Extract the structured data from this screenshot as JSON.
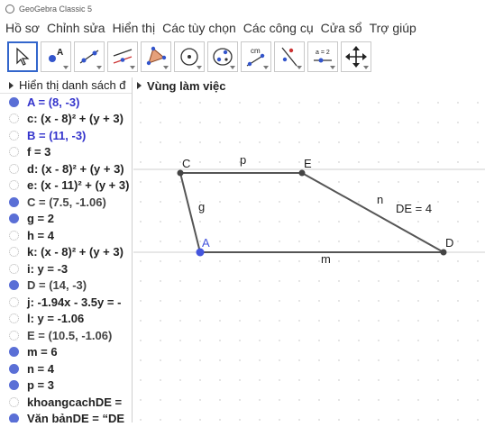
{
  "window": {
    "title": "GeoGebra Classic 5"
  },
  "menu": [
    "Hồ sơ",
    "Chỉnh sửa",
    "Hiển thị",
    "Các tùy chọn",
    "Các công cụ",
    "Cửa sổ",
    "Trợ giúp"
  ],
  "toolbar": {
    "tools": [
      {
        "name": "move-tool-button",
        "icon": "arrow-cursor-icon"
      },
      {
        "name": "point-tool-button",
        "icon": "point-icon"
      },
      {
        "name": "line-tool-button",
        "icon": "line-icon"
      },
      {
        "name": "perpendicular-tool-button",
        "icon": "perpendicular-icon"
      },
      {
        "name": "polygon-tool-button",
        "icon": "polygon-icon"
      },
      {
        "name": "circle-tool-button",
        "icon": "circle-icon"
      },
      {
        "name": "conic-tool-button",
        "icon": "ellipse-icon"
      },
      {
        "name": "distance-tool-button",
        "icon": "measure-icon"
      },
      {
        "name": "reflect-tool-button",
        "icon": "reflect-icon"
      },
      {
        "name": "slider-tool-button",
        "icon": "slider-icon"
      },
      {
        "name": "move-view-tool-button",
        "icon": "move-view-icon"
      }
    ],
    "measure_label": "cm",
    "slider_label": "a = 2"
  },
  "algebra": {
    "header": "Hiển thị danh sách đ",
    "items": [
      {
        "text": "A = (8, -3)",
        "visible": true,
        "color": "#3333cc"
      },
      {
        "text": "c: (x - 8)² + (y + 3)",
        "visible": false,
        "color": "#222222"
      },
      {
        "text": "B = (11, -3)",
        "visible": false,
        "color": "#3333cc"
      },
      {
        "text": "f = 3",
        "visible": false,
        "color": "#222222"
      },
      {
        "text": "d: (x - 8)² + (y + 3)",
        "visible": false,
        "color": "#222222"
      },
      {
        "text": "e: (x - 11)² + (y + 3)",
        "visible": false,
        "color": "#222222"
      },
      {
        "text": "C = (7.5, -1.06)",
        "visible": true,
        "color": "#444444"
      },
      {
        "text": "g = 2",
        "visible": true,
        "color": "#222222"
      },
      {
        "text": "h = 4",
        "visible": false,
        "color": "#222222"
      },
      {
        "text": "k: (x - 8)² + (y + 3)",
        "visible": false,
        "color": "#222222"
      },
      {
        "text": "i: y = -3",
        "visible": false,
        "color": "#222222"
      },
      {
        "text": "D = (14, -3)",
        "visible": true,
        "color": "#444444"
      },
      {
        "text": "j: -1.94x - 3.5y = -",
        "visible": false,
        "color": "#222222"
      },
      {
        "text": "l: y = -1.06",
        "visible": false,
        "color": "#222222"
      },
      {
        "text": "E = (10.5, -1.06)",
        "visible": false,
        "color": "#444444"
      },
      {
        "text": "m = 6",
        "visible": true,
        "color": "#222222"
      },
      {
        "text": "n = 4",
        "visible": true,
        "color": "#222222"
      },
      {
        "text": "p = 3",
        "visible": true,
        "color": "#222222"
      },
      {
        "text": "khoangcachDE =",
        "visible": false,
        "color": "#222222"
      },
      {
        "text": "Văn bảnDE = “DE",
        "visible": true,
        "color": "#222222"
      }
    ]
  },
  "graphics": {
    "header": "Vùng làm việc",
    "labels": {
      "A": "A",
      "C": "C",
      "D": "D",
      "E": "E",
      "p": "p",
      "g": "g",
      "n": "n",
      "m": "m",
      "distance_text": "DE = 4"
    },
    "colors": {
      "point": "#4455dd",
      "black_point": "#444444",
      "segment": "#555555",
      "accent": "#3366cc"
    }
  }
}
